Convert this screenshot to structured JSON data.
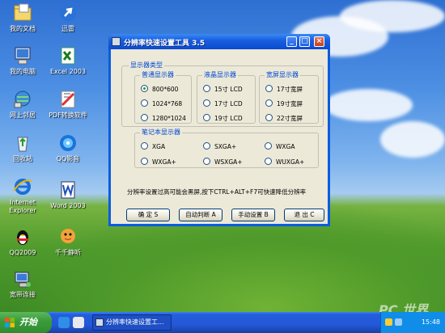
{
  "desktop": {
    "icons": [
      {
        "label": "我的文档"
      },
      {
        "label": "迅雷"
      },
      {
        "label": "我的电脑"
      },
      {
        "label": "Excel 2003"
      },
      {
        "label": "网上邻居"
      },
      {
        "label": "PDF转换软件"
      },
      {
        "label": "回收站"
      },
      {
        "label": "QQ影音"
      },
      {
        "label": "Internet Explorer"
      },
      {
        "label": "Word 2003"
      },
      {
        "label": "QQ2009"
      },
      {
        "label": "千千静听"
      },
      {
        "label": "宽带连接"
      }
    ],
    "watermark": "PC 世界"
  },
  "window": {
    "title": "分辨率快速设置工具 3.5",
    "display_type_legend": "显示器类型",
    "normal": {
      "legend": "普通显示器",
      "options": [
        "800*600",
        "1024*768",
        "1280*1024"
      ],
      "selected": "800*600"
    },
    "lcd": {
      "legend": "液晶显示器",
      "options": [
        "15寸 LCD",
        "17寸 LCD",
        "19寸 LCD"
      ]
    },
    "wide": {
      "legend": "宽屏显示器",
      "options": [
        "17寸宽屏",
        "19寸宽屏",
        "22寸宽屏"
      ]
    },
    "notebook": {
      "legend": "笔记本显示器",
      "options": [
        "XGA",
        "SXGA+",
        "WXGA",
        "WXGA+",
        "WSXGA+",
        "WUXGA+"
      ]
    },
    "hint": "分辨率设置过高可能会黑屏,按下CTRL+ALT+F7可快速降低分辨率",
    "buttons": {
      "ok": "确 定 S",
      "auto": "自动判断 A",
      "manual": "手动设置 B",
      "exit": "退 出 C"
    },
    "title_buttons": {
      "min": "_",
      "max": "□",
      "close": "×"
    }
  },
  "taskbar": {
    "start_label": "开始",
    "task_label": "分辨率快速设置工...",
    "clock": "15:48"
  },
  "colors": {
    "titlebar": "#0a4cd0",
    "dialog_bg": "#ece9d8",
    "legend_text": "#0046d5",
    "start_button": "#3c9d3c",
    "taskbar": "#245edb"
  }
}
